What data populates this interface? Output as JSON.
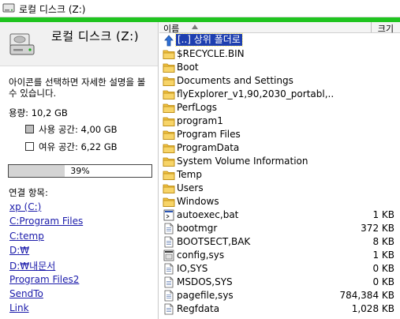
{
  "window": {
    "title": "로컬 디스크 (Z:)"
  },
  "drive": {
    "title": "로컬 디스크 (Z:)",
    "description": "아이콘를 선택하면 자세한 설명을 볼 수 있습니다.",
    "capacity_label": "용량: 10,2 GB",
    "used_label": "사용 공간: 4,00 GB",
    "free_label": "여유 공간: 6,22 GB",
    "usage_percent": 39,
    "usage_text": "39%",
    "used_color": "#bdbdbd",
    "free_color": "#ffffff"
  },
  "links": {
    "heading": "연결 항목:",
    "items": [
      "xp (C:)",
      "C:Program Files",
      "C:temp",
      "D:₩",
      "D:₩내문서",
      "Program Files2",
      "SendTo",
      "Link"
    ]
  },
  "list": {
    "columns": {
      "name": "이름",
      "size": "크기"
    },
    "rows": [
      {
        "icon": "up-folder-icon",
        "name": "[..] 상위 폴더로",
        "size": "",
        "selected": true
      },
      {
        "icon": "folder-icon",
        "name": "$RECYCLE.BIN",
        "size": ""
      },
      {
        "icon": "folder-icon",
        "name": "Boot",
        "size": ""
      },
      {
        "icon": "folder-icon",
        "name": "Documents and Settings",
        "size": ""
      },
      {
        "icon": "folder-icon",
        "name": "flyExplorer_v1,90,2030_portabl,..",
        "size": ""
      },
      {
        "icon": "folder-icon",
        "name": "PerfLogs",
        "size": ""
      },
      {
        "icon": "folder-icon",
        "name": "program1",
        "size": ""
      },
      {
        "icon": "folder-icon",
        "name": "Program Files",
        "size": ""
      },
      {
        "icon": "folder-icon",
        "name": "ProgramData",
        "size": ""
      },
      {
        "icon": "folder-icon",
        "name": "System Volume Information",
        "size": ""
      },
      {
        "icon": "folder-icon",
        "name": "Temp",
        "size": ""
      },
      {
        "icon": "folder-icon",
        "name": "Users",
        "size": ""
      },
      {
        "icon": "folder-icon",
        "name": "Windows",
        "size": ""
      },
      {
        "icon": "batch-file-icon",
        "name": "autoexec,bat",
        "size": "1 KB"
      },
      {
        "icon": "system-file-icon",
        "name": "bootmgr",
        "size": "372 KB"
      },
      {
        "icon": "system-file-icon",
        "name": "BOOTSECT,BAK",
        "size": "8 KB"
      },
      {
        "icon": "config-file-icon",
        "name": "config,sys",
        "size": "1 KB"
      },
      {
        "icon": "system-file-icon",
        "name": "IO,SYS",
        "size": "0 KB"
      },
      {
        "icon": "system-file-icon",
        "name": "MSDOS,SYS",
        "size": "0 KB"
      },
      {
        "icon": "system-file-icon",
        "name": "pagefile,sys",
        "size": "784,384 KB"
      },
      {
        "icon": "system-file-icon",
        "name": "Regfdata",
        "size": "1,028 KB"
      }
    ]
  }
}
